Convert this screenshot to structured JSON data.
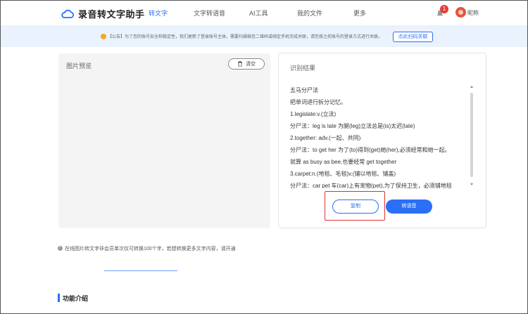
{
  "header": {
    "app_name": "录音转文字助手",
    "nav": [
      {
        "label": "转文字",
        "active": true
      },
      {
        "label": "文字转语音",
        "active": false
      },
      {
        "label": "AI工具",
        "active": false
      },
      {
        "label": "我的文件",
        "active": false
      },
      {
        "label": "更多",
        "active": false
      }
    ],
    "notification_count": "1",
    "nickname": "昵称"
  },
  "notice": {
    "text": "【公告】为了您的账号安全和稳定性，我们更新了登录账号主体。需要扫描微信二维码或绑定手机完成关联，请您按之前账号的登录方式进行关联。",
    "button": "点此扫码关联"
  },
  "preview": {
    "title": "图片预览",
    "clear_label": "清空"
  },
  "result": {
    "title": "识别结果",
    "lines": [
      "五马分尸法",
      "把单词进行拆分记忆。",
      "1.legislate:v.(立法)",
      "分尸法：leg is late 为腿(leg)立法总是(is)太迟(late)",
      "2.together: adv.(一起、共同)",
      "分尸法：to get her 为了(to)得到(get)她(her),必须经常和她一起。",
      "就算 as busy as bee,也要经常 get together",
      "3.carpet:n.(地毯、毛毯)v.(铺以地毯、铺盖)",
      "分尸法：car pet 车(car)上有宠物(pet),为了保持卫生，必须铺地毯"
    ],
    "copy_label": "复制",
    "voice_label": "转语音"
  },
  "footer": {
    "info_text": "在线图片转文字非会员单次仅可转换100个字，若想转换更多文字内容，请开通",
    "section_title": "功能介绍"
  },
  "colors": {
    "accent": "#2a6ff6",
    "notice_bg": "#eaf2fd",
    "highlight": "#e03030"
  }
}
